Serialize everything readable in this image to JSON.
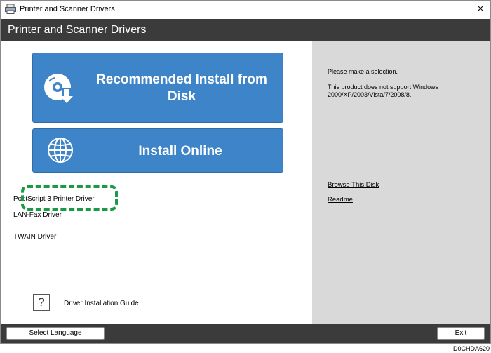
{
  "window": {
    "title": "Printer and Scanner Drivers",
    "close_label": "×"
  },
  "header": {
    "title": "Printer and Scanner Drivers"
  },
  "main": {
    "recommended_install_label": "Recommended Install from Disk",
    "install_online_label": "Install Online",
    "drivers": [
      {
        "label": "PostScript 3 Printer Driver"
      },
      {
        "label": "LAN-Fax Driver"
      },
      {
        "label": "TWAIN Driver"
      }
    ],
    "help_icon_glyph": "?",
    "guide_label": "Driver Installation Guide"
  },
  "info": {
    "prompt": "Please make a selection.",
    "notice": "This product does not support Windows 2000/XP/2003/Vista/7/2008/8.",
    "links": {
      "browse": "Browse This Disk",
      "readme": "Readme"
    }
  },
  "footer": {
    "select_language_label": "Select Language",
    "exit_label": "Exit"
  },
  "figure_code": "D0CHDA620",
  "colors": {
    "button_blue": "#3e84c8",
    "header_dark": "#3b3b3b",
    "side_panel": "#d9d9d9",
    "highlight_green": "#1a9a48"
  }
}
